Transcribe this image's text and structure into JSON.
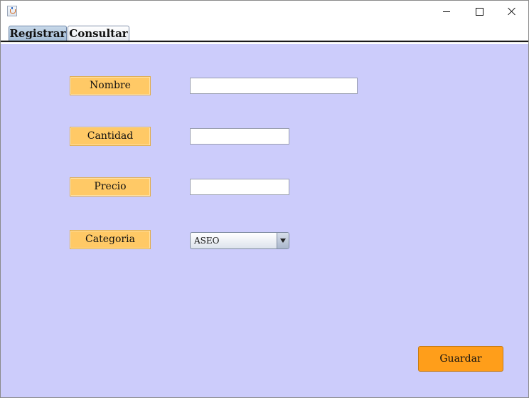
{
  "window": {
    "title": "",
    "controls": [
      "minimize",
      "maximize",
      "close"
    ]
  },
  "tabs": [
    {
      "label": "Registrar",
      "active": true
    },
    {
      "label": "Consultar",
      "active": false
    }
  ],
  "form": {
    "nombre": {
      "label": "Nombre",
      "value": ""
    },
    "cantidad": {
      "label": "Cantidad",
      "value": ""
    },
    "precio": {
      "label": "Precio",
      "value": ""
    },
    "categoria": {
      "label": "Categoria",
      "selected": "ASEO"
    }
  },
  "actions": {
    "save_label": "Guardar"
  },
  "colors": {
    "panel_bg": "#ccccfb",
    "label_bg": "#ffc966",
    "button_bg": "#ff9e1a",
    "active_tab": "#b5cae0"
  }
}
